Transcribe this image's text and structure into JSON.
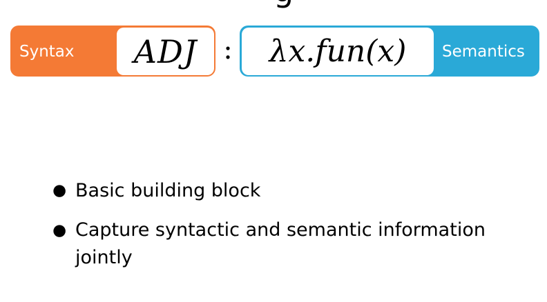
{
  "slide": {
    "title_fragment": "g",
    "syntax": {
      "label": "Syntax",
      "expression": "ADJ",
      "color": "#f47a35"
    },
    "separator": ":",
    "semantics": {
      "label": "Semantics",
      "expression": "λx.fun(x)",
      "color": "#2aa9d7"
    },
    "bullets": [
      {
        "text": "Basic building block"
      },
      {
        "text": "Capture syntactic and semantic information jointly"
      }
    ]
  }
}
